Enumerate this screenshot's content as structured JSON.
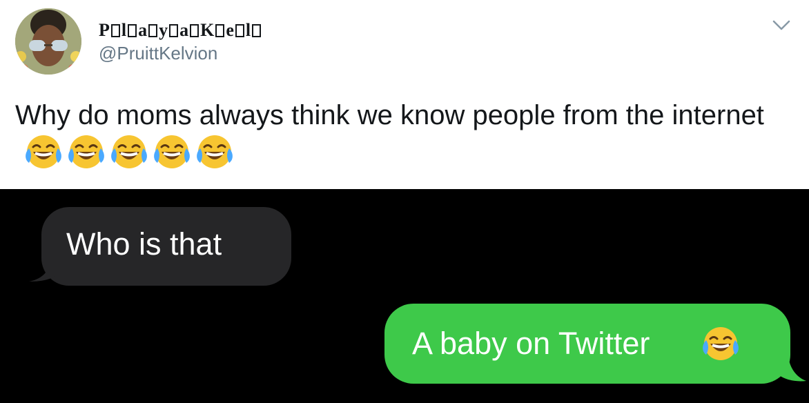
{
  "tweet": {
    "display_name_glyphs": [
      "P",
      "",
      "l",
      "",
      "a",
      "",
      "y",
      "",
      "a",
      "",
      "K",
      "",
      "e",
      "",
      "l",
      ""
    ],
    "handle": "@PruittKelvion",
    "text": "Why do moms always think we know people from the internet",
    "emoji_count": 5,
    "emoji_icon": "face-with-tears-of-joy-icon"
  },
  "conversation": {
    "incoming": "Who is that",
    "outgoing": "A baby on Twitter"
  },
  "colors": {
    "incoming_bubble": "#262628",
    "outgoing_bubble": "#3ec94a",
    "chat_background": "#000000",
    "handle_gray": "#657786"
  }
}
